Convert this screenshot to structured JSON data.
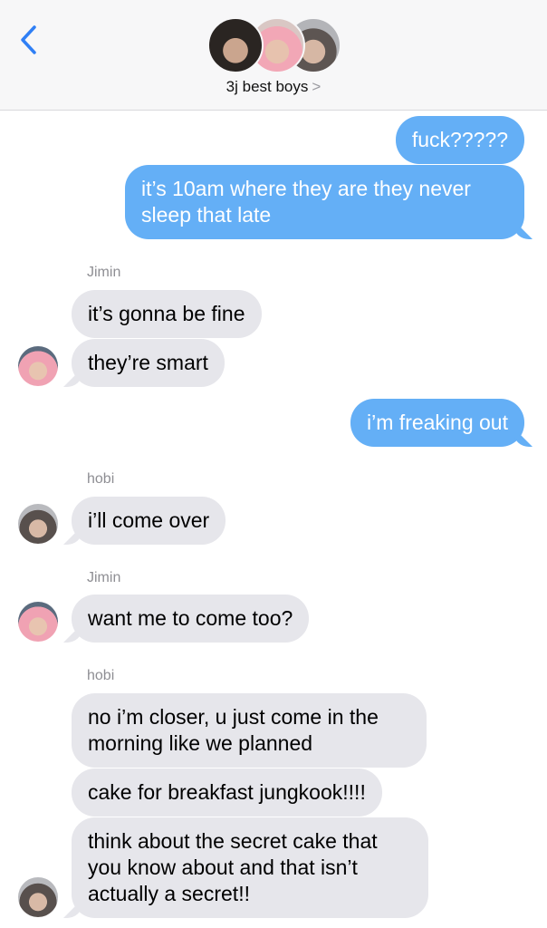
{
  "header": {
    "back_icon": "chevron-left-icon",
    "group_name": "3j best boys",
    "group_chevron": ">",
    "accent": "#2f7ff5"
  },
  "colors": {
    "outgoing": "#64aff6",
    "incoming": "#e6e6eb"
  },
  "messages": {
    "m1": "fuck?????",
    "m2": "it’s 10am where they are they never sleep that late",
    "s1": "Jimin",
    "m3": "it’s gonna be fine",
    "m4": "they’re smart",
    "m5": "i’m freaking out",
    "s2": "hobi",
    "m6": "i’ll come over",
    "s3": "Jimin",
    "m7": "want me to come too?",
    "s4": "hobi",
    "m8": "no i’m closer, u just come in the morning like we planned",
    "m9": "cake for breakfast jungkook!!!!",
    "m10": "think about the secret cake that you know about and that isn’t actually a secret!!"
  }
}
